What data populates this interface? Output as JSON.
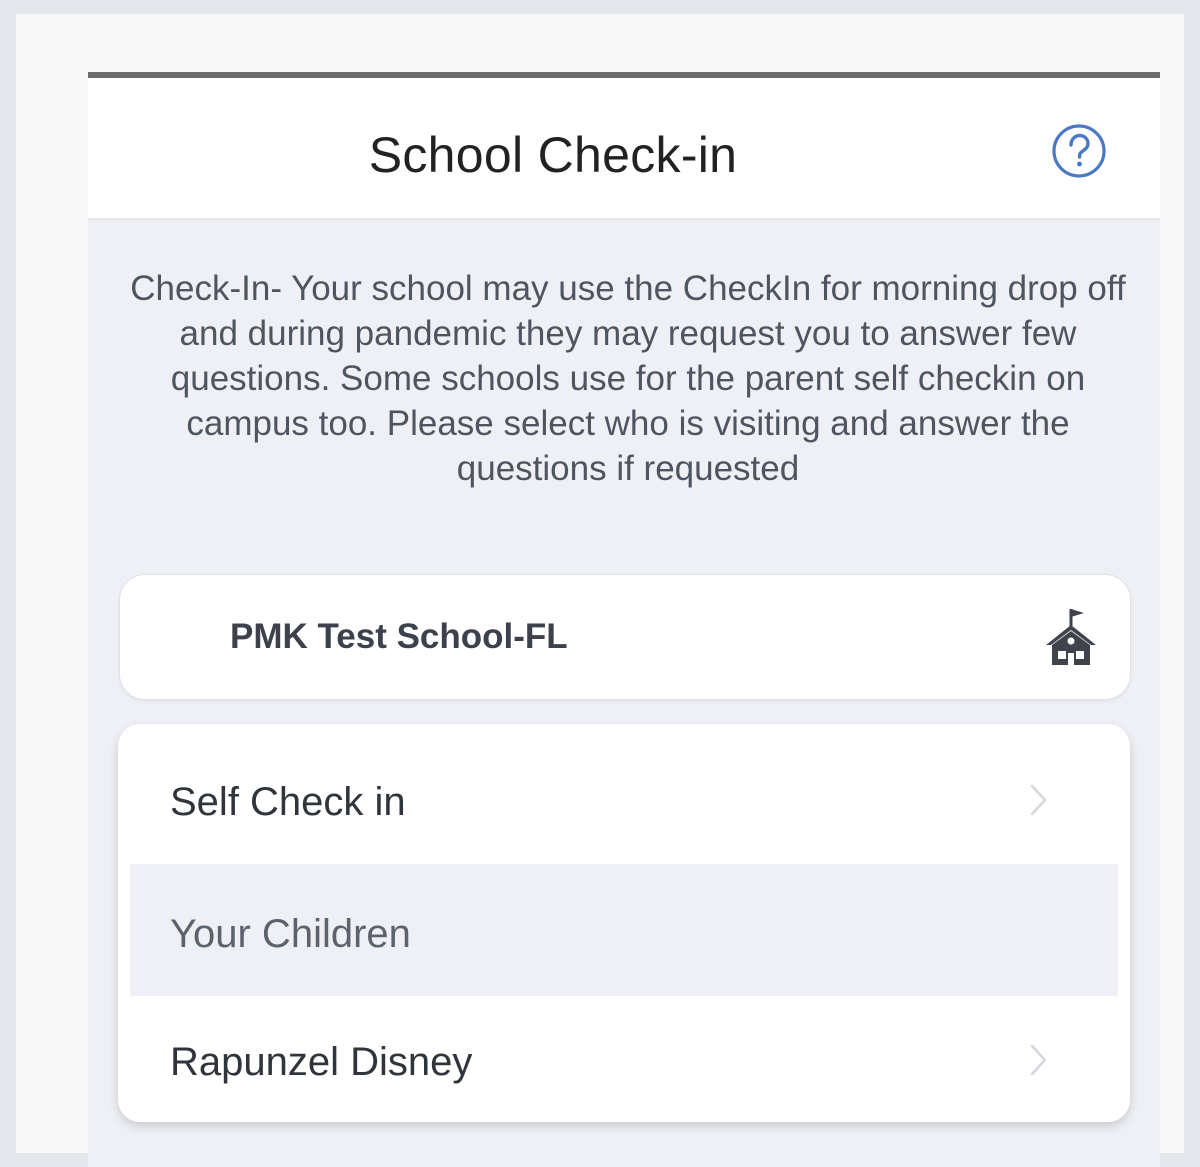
{
  "header": {
    "title": "School Check-in",
    "help_icon": "question-circle-icon"
  },
  "description": "Check-In- Your school may use the CheckIn for morning drop off and during pandemic they may request you to answer few questions. Some schools use for the parent self checkin on campus too. Please select who is visiting and answer the questions if requested",
  "school": {
    "name": "PMK Test School-FL",
    "icon": "school-building-icon"
  },
  "menu": {
    "self_check_in": "Self Check in",
    "children_header": "Your Children",
    "children": [
      {
        "name": "Rapunzel Disney"
      }
    ],
    "chevron_icon": "chevron-right-icon"
  },
  "colors": {
    "accent": "#4a78c4",
    "background": "#eef0f6",
    "text": "#30343b"
  }
}
